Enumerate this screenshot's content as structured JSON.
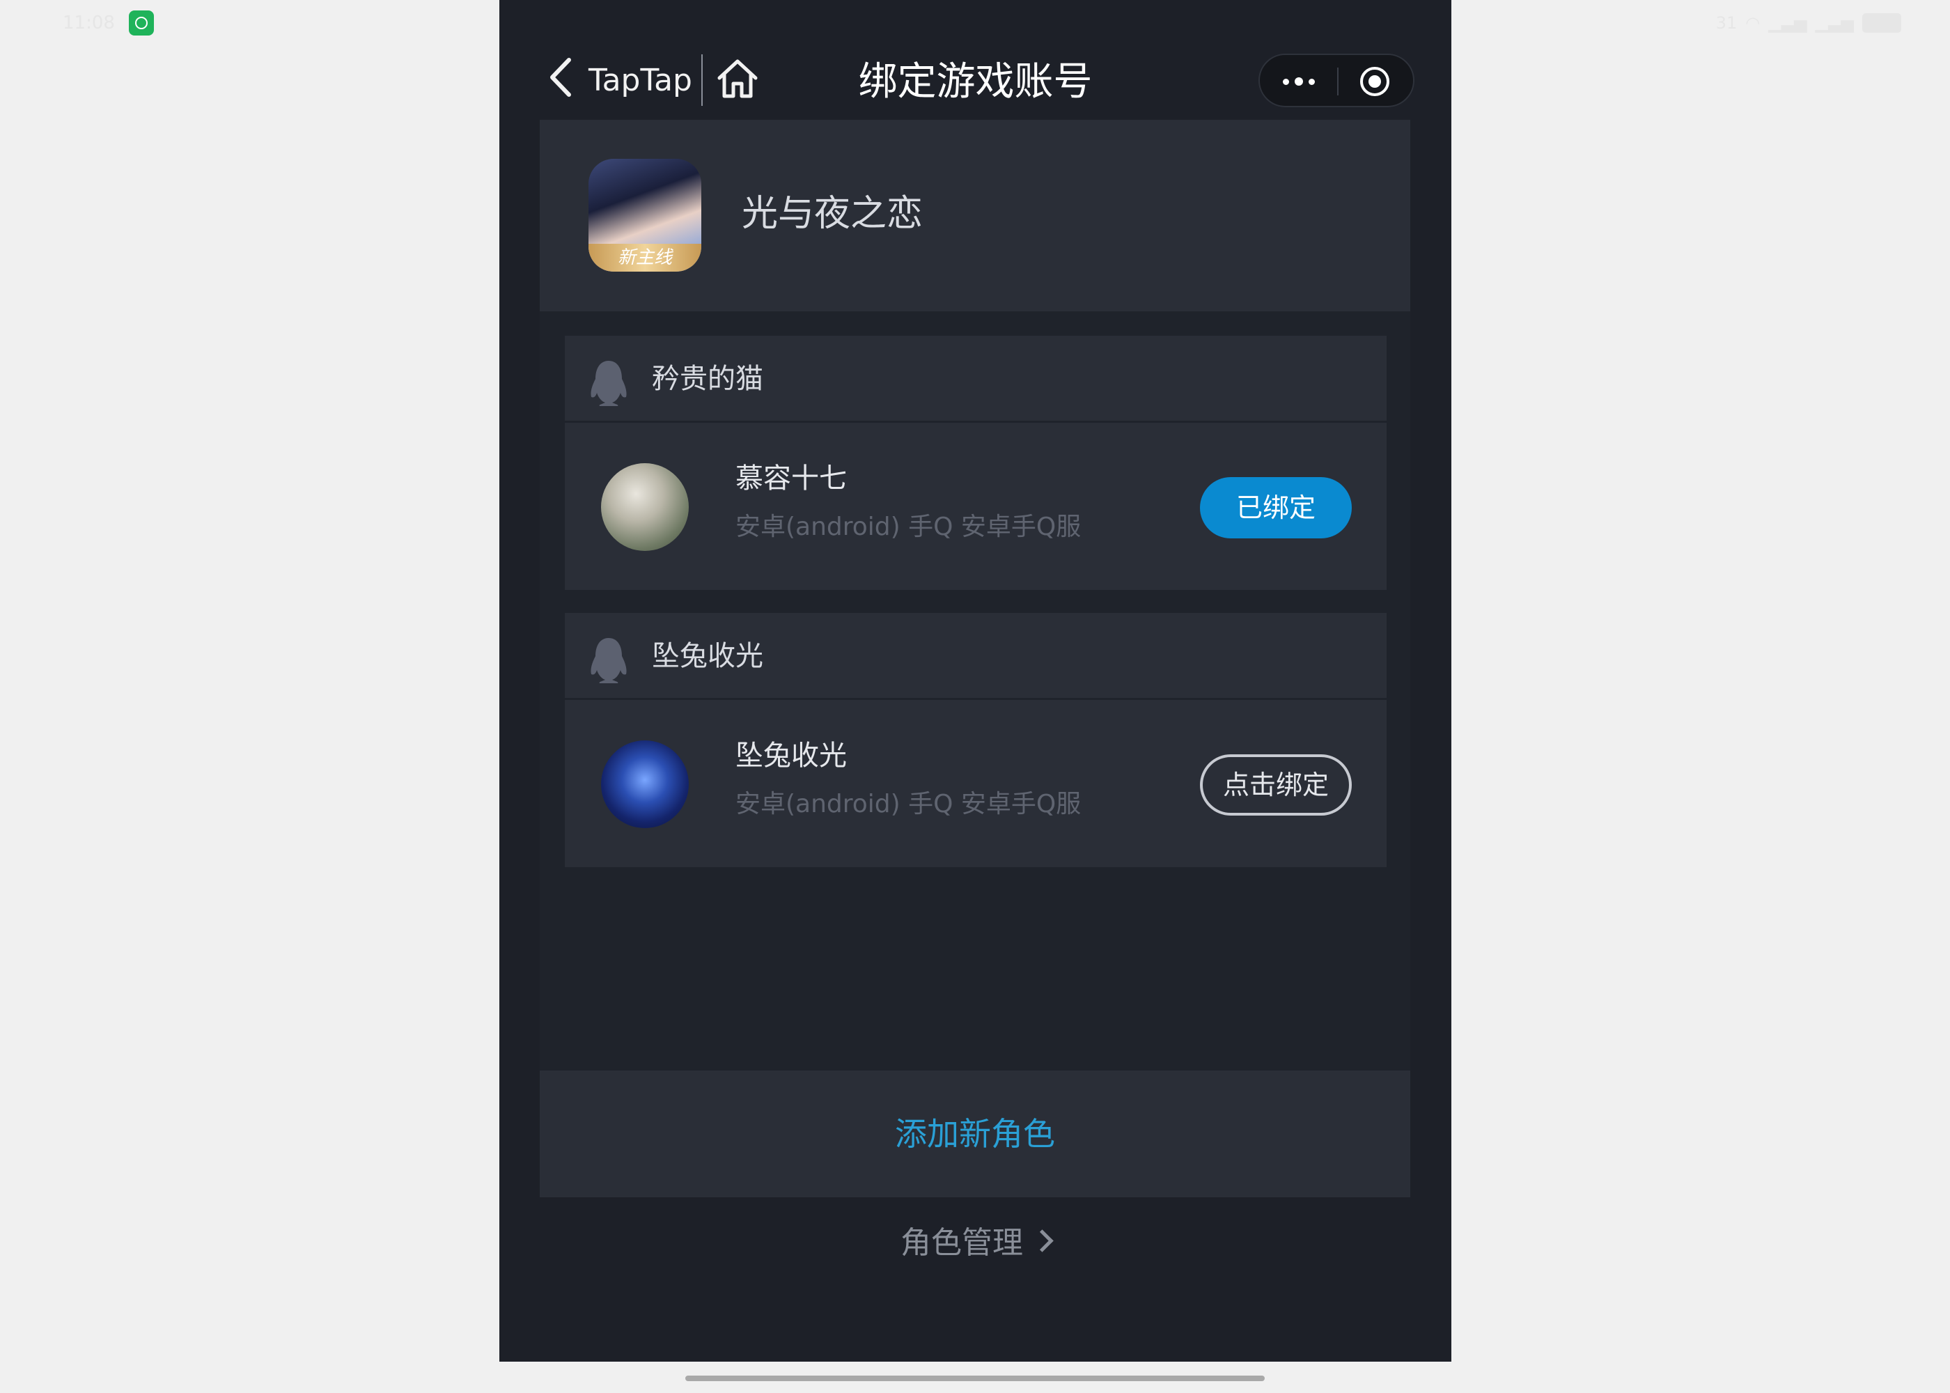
{
  "status": {
    "time": "11:08",
    "right": "31"
  },
  "nav": {
    "back_label": "TapTap",
    "title": "绑定游戏账号"
  },
  "game": {
    "name": "光与夜之恋",
    "badge": "新主线"
  },
  "accounts": [
    {
      "label": "矜贵的猫",
      "role_name": "慕容十七",
      "server": "安卓(android) 手Q 安卓手Q服",
      "button": "已绑定"
    },
    {
      "label": "坠兔收光",
      "role_name": "坠兔收光",
      "server": "安卓(android) 手Q 安卓手Q服",
      "button": "点击绑定"
    }
  ],
  "add_role_label": "添加新角色",
  "manage_label": "角色管理",
  "colors": {
    "accent": "#0a8ad0",
    "link": "#2aa0d6",
    "bg": "#1d2028",
    "card": "#2a2e37"
  }
}
